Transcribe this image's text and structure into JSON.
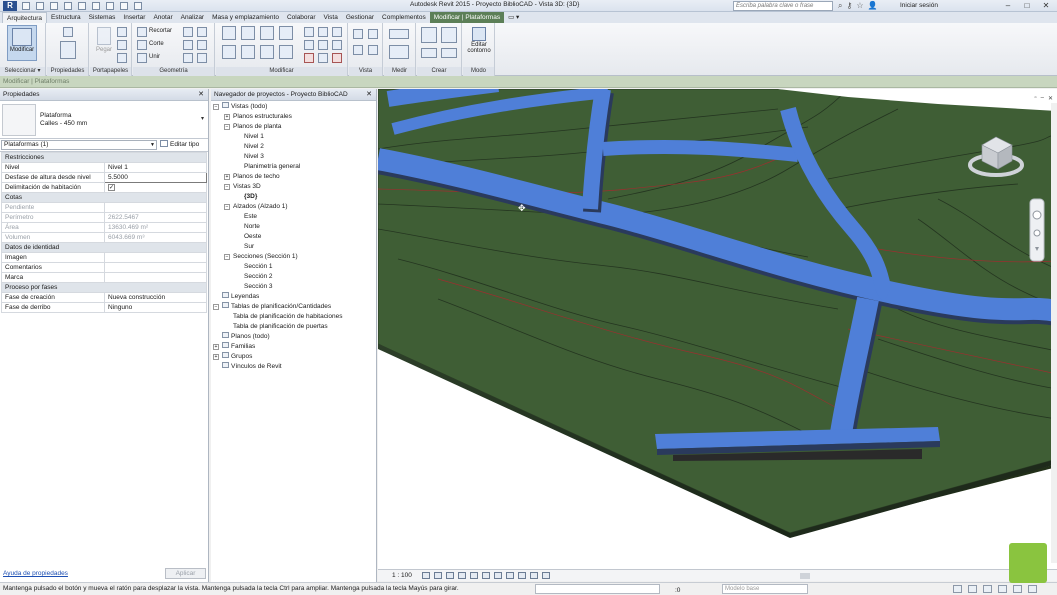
{
  "title_bar": {
    "window_title": "Autodesk Revit 2015 -  Proyecto BiblioCAD - Vista 3D: {3D}",
    "search_placeholder": "Escriba palabra clave o frase",
    "sign_in": "Iniciar sesión"
  },
  "tabs": [
    "Arquitectura",
    "Estructura",
    "Sistemas",
    "Insertar",
    "Anotar",
    "Analizar",
    "Masa y emplazamiento",
    "Colaborar",
    "Vista",
    "Gestionar",
    "Complementos",
    "Modificar | Plataformas"
  ],
  "ribbon": {
    "modify_label": "Modificar",
    "paste_label": "Pegar",
    "panel_labels": {
      "select": "Seleccionar ▾",
      "properties": "Propiedades",
      "clipboard": "Portapapeles",
      "geometry": "Geometría",
      "modify": "Modificar",
      "view": "Vista",
      "measure": "Medir",
      "create": "Crear",
      "mode": "Modo"
    },
    "geometry_buttons": [
      "Recortar",
      "Corte",
      "Unir"
    ],
    "edit_contour": "Editar contorno"
  },
  "options_bar": "Modificar | Plataformas",
  "properties": {
    "header": "Propiedades",
    "type_family": "Plataforma",
    "type_name": "Calles - 450 mm",
    "instance_filter": "Plataformas (1)",
    "edit_type": "Editar tipo",
    "groups": [
      {
        "name": "Restricciones",
        "rows": [
          {
            "label": "Nivel",
            "value": "Nivel 1",
            "state": "normal"
          },
          {
            "label": "Desfase de altura desde nivel",
            "value": "5.5000",
            "state": "input"
          },
          {
            "label": "Delimitación de habitación",
            "value": "✓",
            "state": "check"
          }
        ]
      },
      {
        "name": "Cotas",
        "rows": [
          {
            "label": "Pendiente",
            "value": "",
            "state": "disabled"
          },
          {
            "label": "Perímetro",
            "value": "2622.5467",
            "state": "disabled"
          },
          {
            "label": "Área",
            "value": "13630.469 m²",
            "state": "disabled"
          },
          {
            "label": "Volumen",
            "value": "6043.669 m³",
            "state": "disabled"
          }
        ]
      },
      {
        "name": "Datos de identidad",
        "rows": [
          {
            "label": "Imagen",
            "value": "",
            "state": "normal"
          },
          {
            "label": "Comentarios",
            "value": "",
            "state": "normal"
          },
          {
            "label": "Marca",
            "value": "",
            "state": "normal"
          }
        ]
      },
      {
        "name": "Proceso por fases",
        "rows": [
          {
            "label": "Fase de creación",
            "value": "Nueva construcción",
            "state": "normal"
          },
          {
            "label": "Fase de derribo",
            "value": "Ninguno",
            "state": "normal"
          }
        ]
      }
    ],
    "help_link": "Ayuda de propiedades",
    "apply": "Aplicar"
  },
  "browser": {
    "header": "Navegador de proyectos - Proyecto BiblioCAD",
    "nodes": [
      {
        "label": "Vistas (todo)",
        "depth": 0,
        "toggle": "−",
        "icon": true
      },
      {
        "label": "Planos estructurales",
        "depth": 1,
        "toggle": "+",
        "icon": false
      },
      {
        "label": "Planos de planta",
        "depth": 1,
        "toggle": "−",
        "icon": false
      },
      {
        "label": "Nivel 1",
        "depth": 2,
        "toggle": "",
        "icon": false
      },
      {
        "label": "Nivel 2",
        "depth": 2,
        "toggle": "",
        "icon": false
      },
      {
        "label": "Nivel 3",
        "depth": 2,
        "toggle": "",
        "icon": false
      },
      {
        "label": "Planimetría general",
        "depth": 2,
        "toggle": "",
        "icon": false
      },
      {
        "label": "Planos de techo",
        "depth": 1,
        "toggle": "+",
        "icon": false
      },
      {
        "label": "Vistas 3D",
        "depth": 1,
        "toggle": "−",
        "icon": false
      },
      {
        "label": "{3D}",
        "depth": 2,
        "toggle": "",
        "icon": false,
        "bold": true
      },
      {
        "label": "Alzados (Alzado 1)",
        "depth": 1,
        "toggle": "−",
        "icon": false
      },
      {
        "label": "Este",
        "depth": 2,
        "toggle": "",
        "icon": false
      },
      {
        "label": "Norte",
        "depth": 2,
        "toggle": "",
        "icon": false
      },
      {
        "label": "Oeste",
        "depth": 2,
        "toggle": "",
        "icon": false
      },
      {
        "label": "Sur",
        "depth": 2,
        "toggle": "",
        "icon": false
      },
      {
        "label": "Secciones (Sección 1)",
        "depth": 1,
        "toggle": "−",
        "icon": false
      },
      {
        "label": "Sección 1",
        "depth": 2,
        "toggle": "",
        "icon": false
      },
      {
        "label": "Sección 2",
        "depth": 2,
        "toggle": "",
        "icon": false
      },
      {
        "label": "Sección 3",
        "depth": 2,
        "toggle": "",
        "icon": false
      },
      {
        "label": "Leyendas",
        "depth": 0,
        "toggle": "",
        "icon": true
      },
      {
        "label": "Tablas de planificación/Cantidades",
        "depth": 0,
        "toggle": "−",
        "icon": true
      },
      {
        "label": "Tabla de planificación de habitaciones",
        "depth": 1,
        "toggle": "",
        "icon": false
      },
      {
        "label": "Tabla de planificación de puertas",
        "depth": 1,
        "toggle": "",
        "icon": false
      },
      {
        "label": "Planos (todo)",
        "depth": 0,
        "toggle": "",
        "icon": true
      },
      {
        "label": "Familias",
        "depth": 0,
        "toggle": "+",
        "icon": true
      },
      {
        "label": "Grupos",
        "depth": 0,
        "toggle": "+",
        "icon": true
      },
      {
        "label": "Vínculos de Revit",
        "depth": 0,
        "toggle": "",
        "icon": true
      }
    ]
  },
  "view_bar": {
    "scale": "1 : 100"
  },
  "status_bar": {
    "message": "Mantenga pulsado el botón y mueva el ratón para desplazar la vista. Mantenga pulsada la tecla Ctrl para ampliar. Mantenga pulsada la tecla Mayús para girar.",
    "model_combo": "Modelo base",
    "count": ":0"
  },
  "colors": {
    "terrain": "#3f5e35",
    "road": "#4f7fd8",
    "road_side": "#2a3a5c",
    "options_bar": "#c8d6bf",
    "active_tab": "#5c7f57"
  }
}
